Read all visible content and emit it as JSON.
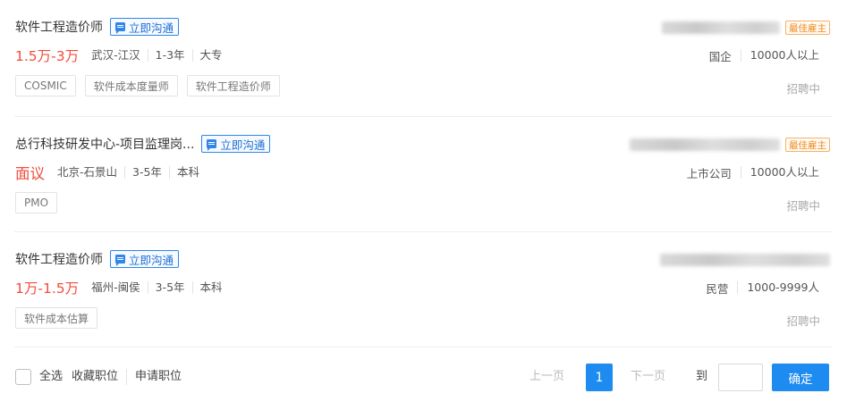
{
  "chat_label": "立即沟通",
  "best_employer_label": "最佳雇主",
  "jobs": [
    {
      "title": "软件工程造价师",
      "salary": "1.5万-3万",
      "location": "武汉-江汉",
      "experience": "1-3年",
      "education": "大专",
      "company_name": "盛…软件有限…",
      "company_type": "国企",
      "company_size": "10000人以上",
      "tags": [
        "COSMIC",
        "软件成本度量师",
        "软件工程造价师"
      ],
      "status": "招聘中",
      "best_employer": true
    },
    {
      "title": "总行科技研发中心-项目监理岗...",
      "salary": "面议",
      "location": "北京-石景山",
      "experience": "3-5年",
      "education": "本科",
      "company_name": "",
      "company_type": "上市公司",
      "company_size": "10000人以上",
      "tags": [
        "PMO"
      ],
      "status": "招聘中",
      "best_employer": true
    },
    {
      "title": "软件工程造价师",
      "salary": "1万-1.5万",
      "location": "福州-闽侯",
      "experience": "3-5年",
      "education": "本科",
      "company_name": "",
      "company_type": "民营",
      "company_size": "1000-9999人",
      "tags": [
        "软件成本估算"
      ],
      "status": "招聘中",
      "best_employer": false
    }
  ],
  "footer": {
    "select_all": "全选",
    "favorite": "收藏职位",
    "apply": "申请职位"
  },
  "pagination": {
    "prev": "上一页",
    "current": "1",
    "next": "下一页",
    "goto": "到",
    "confirm": "确定",
    "input_value": ""
  },
  "colors": {
    "accent": "#1e8bf0",
    "salary": "#f14d3d",
    "best_employer": "#f08a1c"
  }
}
